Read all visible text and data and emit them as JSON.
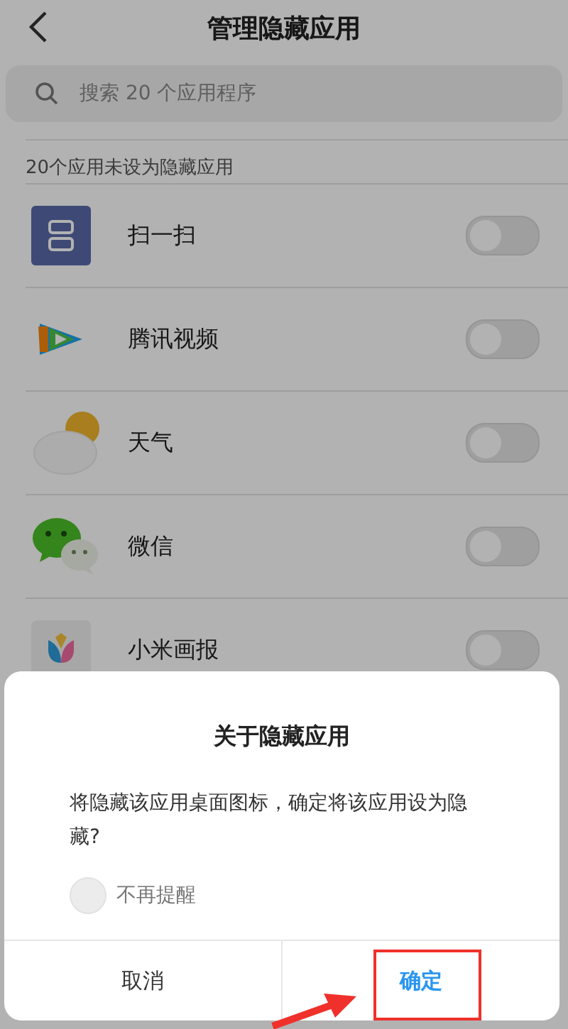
{
  "header": {
    "title": "管理隐藏应用"
  },
  "search": {
    "placeholder": "搜索 20 个应用程序"
  },
  "section_label": "20个应用未设为隐藏应用",
  "apps": [
    {
      "name": "扫一扫",
      "kind": "scan",
      "on": false
    },
    {
      "name": "腾讯视频",
      "kind": "video",
      "on": false
    },
    {
      "name": "天气",
      "kind": "weather",
      "on": false
    },
    {
      "name": "微信",
      "kind": "chat",
      "on": false
    },
    {
      "name": "小米画报",
      "kind": "gallery",
      "on": false
    }
  ],
  "dialog": {
    "title": "关于隐藏应用",
    "message": "将隐藏该应用桌面图标，确定将该应用设为隐藏?",
    "checkbox": {
      "label": "不再提醒",
      "checked": false
    },
    "buttons": [
      {
        "label": "取消",
        "kind": "cancel"
      },
      {
        "label": "确定",
        "kind": "confirm"
      }
    ]
  }
}
